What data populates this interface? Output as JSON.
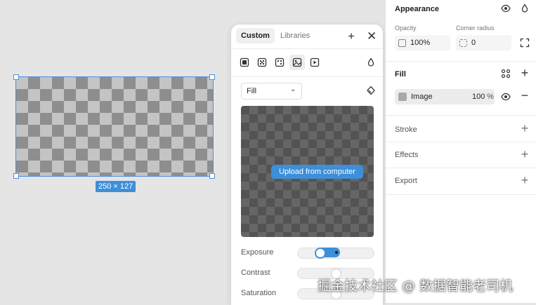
{
  "canvas": {
    "size_label": "250 × 127"
  },
  "popover": {
    "tabs": [
      {
        "label": "Custom"
      },
      {
        "label": "Libraries"
      }
    ],
    "fill_mode": "Fill",
    "upload_label": "Upload from computer",
    "adjustments": [
      {
        "label": "Exposure",
        "value": 0.3
      },
      {
        "label": "Contrast",
        "value": 0.5
      },
      {
        "label": "Saturation",
        "value": 0.5
      }
    ]
  },
  "panel": {
    "appearance": {
      "title": "Appearance",
      "opacity_label": "Opacity",
      "opacity_value": "100%",
      "radius_label": "Corner radius",
      "radius_value": "0"
    },
    "fill": {
      "title": "Fill",
      "type": "Image",
      "opacity": "100",
      "unit": "%"
    },
    "stroke": {
      "title": "Stroke"
    },
    "effects": {
      "title": "Effects"
    },
    "export": {
      "title": "Export"
    }
  },
  "watermark": "掘金技术社区 @ 数据智能老司机",
  "colors": {
    "accent": "#3d8fd8",
    "selection": "#4a90e2"
  }
}
